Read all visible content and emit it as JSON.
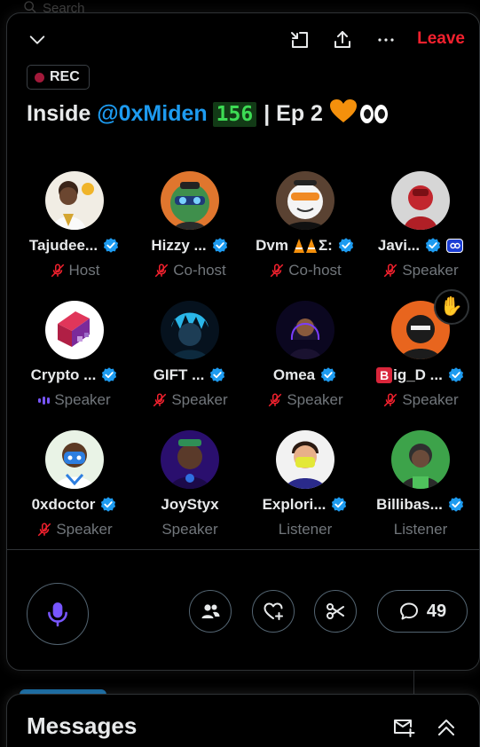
{
  "search": {
    "placeholder": "Search"
  },
  "space": {
    "rec_label": "REC",
    "title_prefix": "Inside",
    "title_mention": "@0xMiden",
    "title_count": "156",
    "title_rest": "| Ep 2",
    "leave_label": "Leave",
    "icons": [
      "chevron-down-icon",
      "minimize-icon",
      "share-icon",
      "more-icon"
    ]
  },
  "participants": [
    {
      "name": "Tajudee...",
      "role": "Host",
      "verified": true,
      "muted": true
    },
    {
      "name": "Hizzy ...",
      "role": "Co-host",
      "verified": true,
      "muted": true
    },
    {
      "name": "Dvm🡍🡍Σ:",
      "name_display": "Dvm",
      "name_suffix": "Σ:",
      "role": "Co-host",
      "verified": true,
      "muted": true
    },
    {
      "name": "Javi...",
      "role": "Speaker",
      "verified": true,
      "muted": true,
      "extra_badge": true
    },
    {
      "name": "Crypto ...",
      "role": "Speaker",
      "verified": true,
      "muted": false,
      "speaking": true
    },
    {
      "name": "GIFT ...",
      "role": "Speaker",
      "verified": true,
      "muted": true
    },
    {
      "name": "Omea",
      "role": "Speaker",
      "verified": true,
      "muted": true
    },
    {
      "name": "ig_D ...",
      "name_badge": "B",
      "role": "Speaker",
      "verified": true,
      "muted": true,
      "hand_raised": true
    },
    {
      "name": "0xdoctor",
      "role": "Speaker",
      "verified": true,
      "muted": true
    },
    {
      "name": "JoyStyx",
      "role": "Speaker",
      "verified": false,
      "muted": false
    },
    {
      "name": "Explori...",
      "role": "Listener",
      "verified": true,
      "muted": false
    },
    {
      "name": "Billibas...",
      "role": "Listener",
      "verified": true,
      "muted": false
    }
  ],
  "controls": {
    "comment_count": "49",
    "icons": [
      "microphone-icon",
      "people-icon",
      "heart-plus-icon",
      "scissors-icon",
      "comment-icon"
    ]
  },
  "messages": {
    "title": "Messages",
    "icons": [
      "new-message-icon",
      "collapse-up-icon"
    ]
  },
  "colors": {
    "accent": "#1d9bf0",
    "leave": "#f4212e",
    "muted_mic": "#f4212e",
    "rec_dot": "#a2193a",
    "mic": "#7856ff",
    "count_tag_bg": "#123a16",
    "count_tag_text": "#3ddc54"
  }
}
